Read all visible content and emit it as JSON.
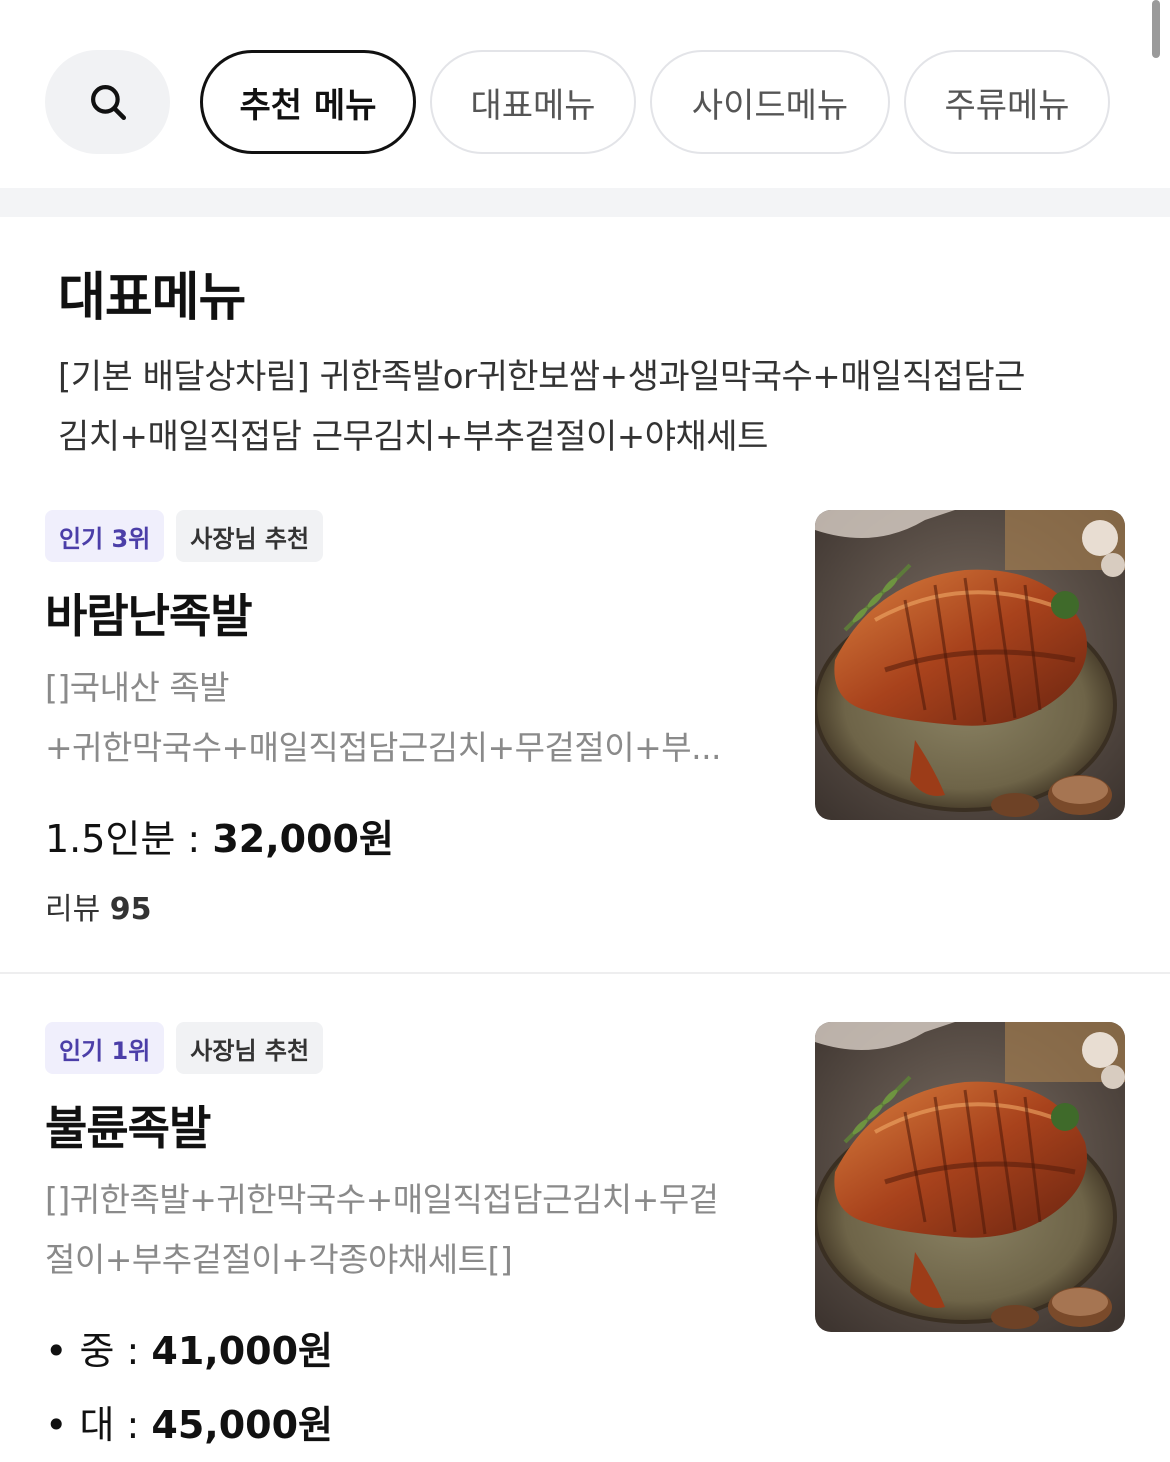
{
  "filters": {
    "search_icon": "search-icon",
    "chips": [
      {
        "label": "추천 메뉴",
        "active": true
      },
      {
        "label": "대표메뉴",
        "active": false
      },
      {
        "label": "사이드메뉴",
        "active": false
      },
      {
        "label": "주류메뉴",
        "active": false
      }
    ]
  },
  "section": {
    "title": "대표메뉴",
    "description_line1": "[기본 배달상차림] 귀한족발or귀한보쌈+생과일막국수+매일직접담근",
    "description_line2": "김치+매일직접담 근무김치+부추겉절이+야채세트"
  },
  "items": [
    {
      "rank_badge": "인기 3위",
      "owner_badge": "사장님 추천",
      "name": "바람난족발",
      "desc_line1": "[]국내산 족발",
      "desc_line2": "+귀한막국수+매일직접담근김치+무겉절이+부...",
      "price_label": "1.5인분 : ",
      "price_value": "32,000원",
      "review_label": "리뷰 ",
      "review_count": "95",
      "image_icon": "jokbal-photo"
    },
    {
      "rank_badge": "인기 1위",
      "owner_badge": "사장님 추천",
      "name": "불륜족발",
      "desc_line1": "[]귀한족발+귀한막국수+매일직접담근김치+무겉",
      "desc_line2": "절이+부추겉절이+각종야채세트[]",
      "prices": [
        {
          "label": "• 중 : ",
          "value": "41,000원"
        },
        {
          "label": "• 대 : ",
          "value": "45,000원"
        }
      ],
      "image_icon": "jokbal-photo"
    }
  ],
  "colors": {
    "accent_badge_bg": "#f0effc",
    "accent_badge_text": "#4b3ea8",
    "chip_border": "#e3e4e8"
  }
}
